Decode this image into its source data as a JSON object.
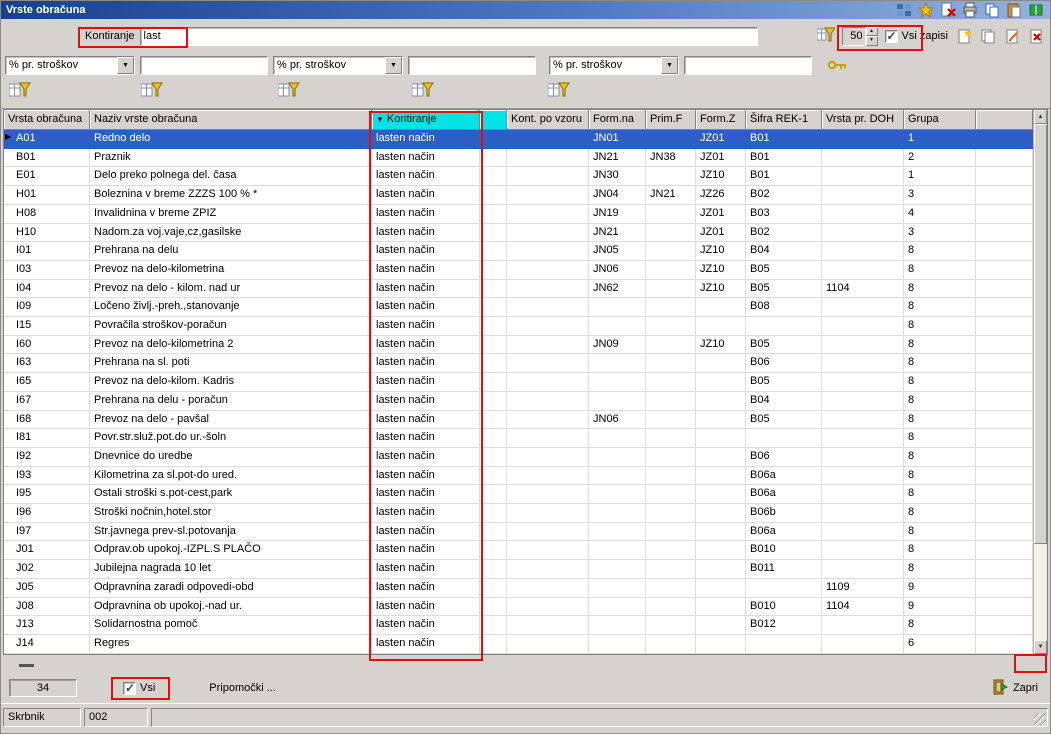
{
  "window": {
    "title": "Vrste obračuna"
  },
  "titlebar": {
    "icons": [
      "window-tiles-icon",
      "favorite-star-icon",
      "document-delete-icon",
      "print-icon",
      "copy-icon",
      "paste-icon",
      "help-books-icon"
    ]
  },
  "toolbar": {
    "kontiranje_label": "Kontiranje",
    "kontiranje_value": "last",
    "page_size": "50",
    "vsi_zapisi_label": "Vsi zapisi",
    "vsi_zapisi_checked": true,
    "icons": [
      "advanced-filter-icon",
      "insert-record-icon",
      "duplicate-record-icon",
      "edit-record-icon",
      "delete-record-icon"
    ]
  },
  "filterbar": {
    "combos": [
      {
        "value": "% pr. stroškov",
        "input": ""
      },
      {
        "value": "% pr. stroškov",
        "input": ""
      },
      {
        "value": "% pr. stroškov",
        "input": ""
      }
    ],
    "key_icon": "key-icon",
    "column_filter_icon": "column-filter-icon"
  },
  "table": {
    "sort_indicator": "▼",
    "row_pointer": "▶",
    "selected_index": 0,
    "columns": [
      {
        "label": "Vrsta obračuna"
      },
      {
        "label": "Naziv vrste obračuna"
      },
      {
        "label": "Kontiranje",
        "sorted": true,
        "highlight": true
      },
      {
        "label": "",
        "highlight": true
      },
      {
        "label": "Kont. po vzoru"
      },
      {
        "label": "Form.na"
      },
      {
        "label": "Prim.F"
      },
      {
        "label": "Form.Z"
      },
      {
        "label": "Šifra REK-1"
      },
      {
        "label": "Vrsta pr. DOH"
      },
      {
        "label": "Grupa"
      }
    ],
    "rows": [
      [
        "A01",
        "Redno delo",
        "lasten način",
        "",
        "",
        "JN01",
        "",
        "JZ01",
        "B01",
        "",
        "1"
      ],
      [
        "B01",
        "Praznik",
        "lasten način",
        "",
        "",
        "JN21",
        "JN38",
        "JZ01",
        "B01",
        "",
        "2"
      ],
      [
        "E01",
        "Delo preko polnega del. časa",
        "lasten način",
        "",
        "",
        "JN30",
        "",
        "JZ10",
        "B01",
        "",
        "1"
      ],
      [
        "H01",
        "Boleznina v breme ZZZS 100 % *",
        "lasten način",
        "",
        "",
        "JN04",
        "JN21",
        "JZ26",
        "B02",
        "",
        "3"
      ],
      [
        "H08",
        "Invalidnina v breme ZPIZ",
        "lasten način",
        "",
        "",
        "JN19",
        "",
        "JZ01",
        "B03",
        "",
        "4"
      ],
      [
        "H10",
        "Nadom.za voj.vaje,cz,gasilske",
        "lasten način",
        "",
        "",
        "JN21",
        "",
        "JZ01",
        "B02",
        "",
        "3"
      ],
      [
        "I01",
        "Prehrana na delu",
        "lasten način",
        "",
        "",
        "JN05",
        "",
        "JZ10",
        "B04",
        "",
        "8"
      ],
      [
        "I03",
        "Prevoz na delo-kilometrina",
        "lasten način",
        "",
        "",
        "JN06",
        "",
        "JZ10",
        "B05",
        "",
        "8"
      ],
      [
        "I04",
        "Prevoz na delo - kilom. nad ur",
        "lasten način",
        "",
        "",
        "JN62",
        "",
        "JZ10",
        "B05",
        "1104",
        "8"
      ],
      [
        "I09",
        "Ločeno življ.-preh.,stanovanje",
        "lasten način",
        "",
        "",
        "",
        "",
        "",
        "B08",
        "",
        "8"
      ],
      [
        "I15",
        "Povračila stroškov-poračun",
        "lasten način",
        "",
        "",
        "",
        "",
        "",
        "",
        "",
        "8"
      ],
      [
        "I60",
        "Prevoz na delo-kilometrina 2",
        "lasten način",
        "",
        "",
        "JN09",
        "",
        "JZ10",
        "B05",
        "",
        "8"
      ],
      [
        "I63",
        "Prehrana na sl. poti",
        "lasten način",
        "",
        "",
        "",
        "",
        "",
        "B06",
        "",
        "8"
      ],
      [
        "I65",
        "Prevoz na delo-kilom. Kadris",
        "lasten način",
        "",
        "",
        "",
        "",
        "",
        "B05",
        "",
        "8"
      ],
      [
        "I67",
        "Prehrana na delu - poračun",
        "lasten način",
        "",
        "",
        "",
        "",
        "",
        "B04",
        "",
        "8"
      ],
      [
        "I68",
        "Prevoz na delo - pavšal",
        "lasten način",
        "",
        "",
        "JN06",
        "",
        "",
        "B05",
        "",
        "8"
      ],
      [
        "I81",
        "Povr.str.služ.pot.do ur.-šoln",
        "lasten način",
        "",
        "",
        "",
        "",
        "",
        "",
        "",
        "8"
      ],
      [
        "I92",
        "Dnevnice do uredbe",
        "lasten način",
        "",
        "",
        "",
        "",
        "",
        "B06",
        "",
        "8"
      ],
      [
        "I93",
        "Kilometrina za sl.pot-do ured.",
        "lasten način",
        "",
        "",
        "",
        "",
        "",
        "B06a",
        "",
        "8"
      ],
      [
        "I95",
        "Ostali stroški s.pot-cest,park",
        "lasten način",
        "",
        "",
        "",
        "",
        "",
        "B06a",
        "",
        "8"
      ],
      [
        "I96",
        "Stroški nočnin,hotel.stor",
        "lasten način",
        "",
        "",
        "",
        "",
        "",
        "B06b",
        "",
        "8"
      ],
      [
        "I97",
        "Str.javnega prev-sl.potovanja",
        "lasten način",
        "",
        "",
        "",
        "",
        "",
        "B06a",
        "",
        "8"
      ],
      [
        "J01",
        "Odprav.ob upokoj.-IZPL.S PLAČO",
        "lasten način",
        "",
        "",
        "",
        "",
        "",
        "B010",
        "",
        "8"
      ],
      [
        "J02",
        "Jubilejna nagrada 10 let",
        "lasten način",
        "",
        "",
        "",
        "",
        "",
        "B011",
        "",
        "8"
      ],
      [
        "J05",
        "Odpravnina zaradi odpovedi-obd",
        "lasten način",
        "",
        "",
        "",
        "",
        "",
        "",
        "1109",
        "9"
      ],
      [
        "J08",
        "Odpravnina ob upokoj.-nad ur.",
        "lasten način",
        "",
        "",
        "",
        "",
        "",
        "B010",
        "1104",
        "9"
      ],
      [
        "J13",
        "Solidarnostna pomoč",
        "lasten način",
        "",
        "",
        "",
        "",
        "",
        "B012",
        "",
        "8"
      ],
      [
        "J14",
        "Regres",
        "lasten način",
        "",
        "",
        "",
        "",
        "",
        "",
        "",
        "6"
      ]
    ]
  },
  "footer": {
    "record_count": "34",
    "vsi_label": "Vsi",
    "vsi_checked": true,
    "pripomocki_label": "Pripomočki ...",
    "zapri_label": "Zapri",
    "zapri_icon": "exit-door-icon"
  },
  "statusbar": {
    "panels": [
      "Skrbnik",
      "002",
      ""
    ]
  },
  "annotation_color": "#dd1111"
}
